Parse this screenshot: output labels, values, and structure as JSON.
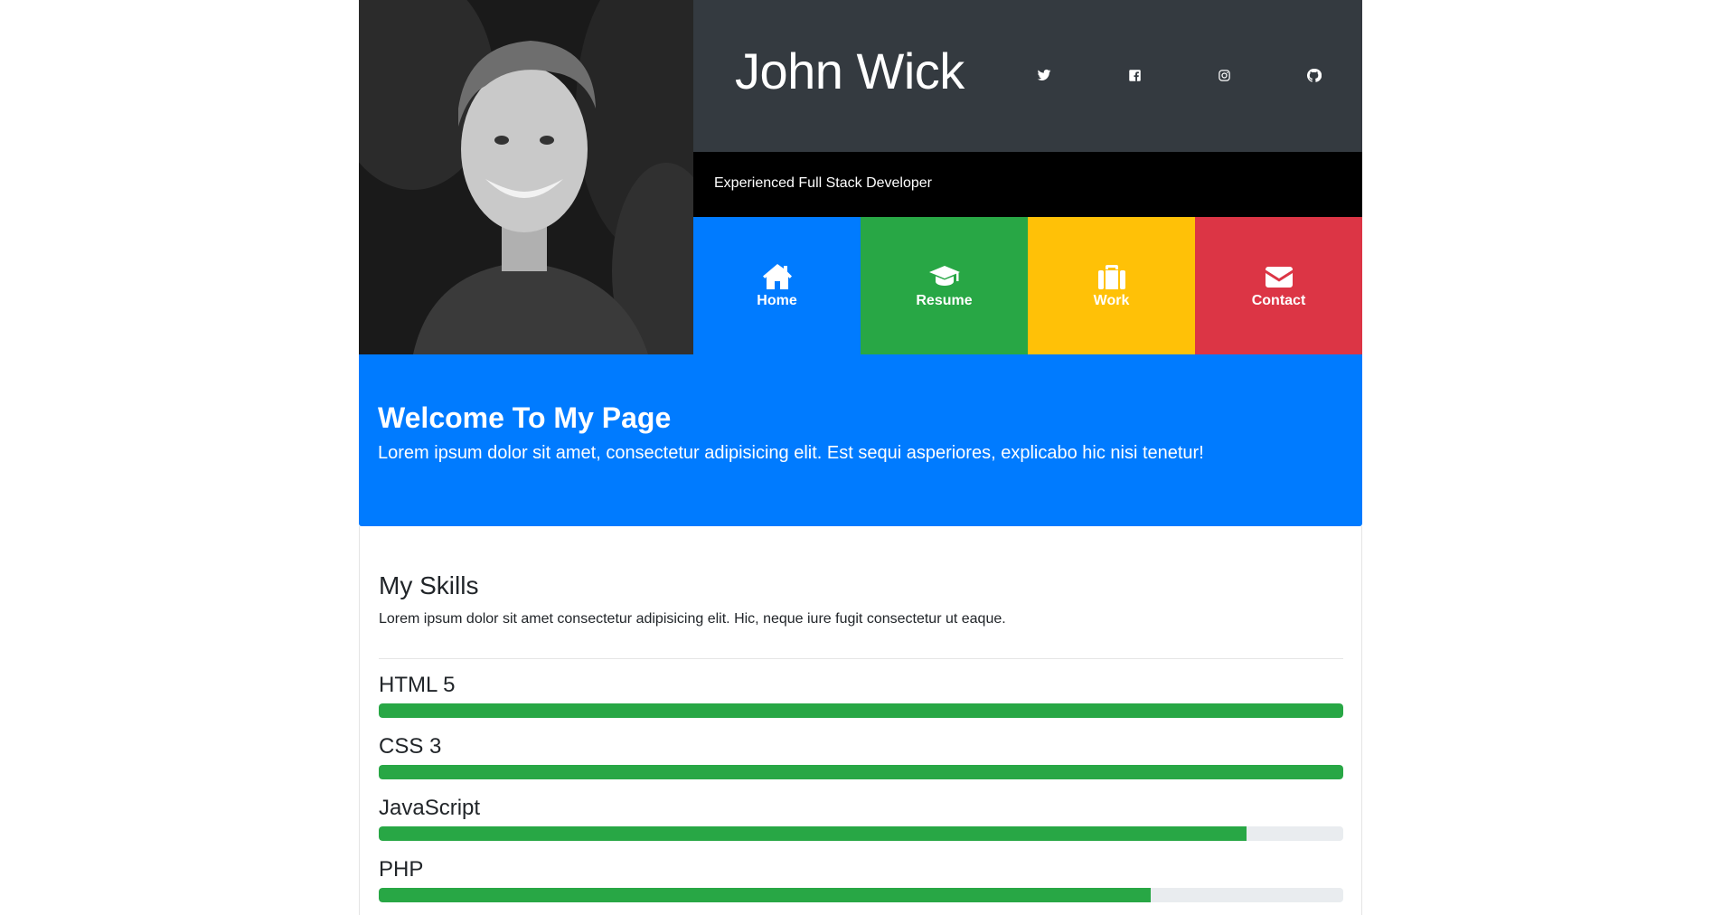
{
  "header": {
    "name": "John Wick",
    "tagline": "Experienced Full Stack Developer",
    "social": [
      {
        "icon": "twitter-icon"
      },
      {
        "icon": "facebook-icon"
      },
      {
        "icon": "instagram-icon"
      },
      {
        "icon": "github-icon"
      }
    ]
  },
  "nav": [
    {
      "label": "Home",
      "icon": "home-icon",
      "color": "#007bff"
    },
    {
      "label": "Resume",
      "icon": "graduation-cap-icon",
      "color": "#28a745"
    },
    {
      "label": "Work",
      "icon": "briefcase-icon",
      "color": "#ffc107"
    },
    {
      "label": "Contact",
      "icon": "envelope-icon",
      "color": "#dc3545"
    }
  ],
  "welcome": {
    "title": "Welcome To My Page",
    "text": "Lorem ipsum dolor sit amet, consectetur adipisicing elit. Est sequi asperiores, explicabo hic nisi tenetur!"
  },
  "skills": {
    "title": "My Skills",
    "text": "Lorem ipsum dolor sit amet consectetur adipisicing elit. Hic, neque iure fugit consectetur ut eaque.",
    "items": [
      {
        "label": "HTML 5",
        "percent": 100
      },
      {
        "label": "CSS 3",
        "percent": 100
      },
      {
        "label": "JavaScript",
        "percent": 90
      },
      {
        "label": "PHP",
        "percent": 80
      }
    ]
  },
  "colors": {
    "dark": "#343a40",
    "primary": "#007bff",
    "success": "#28a745",
    "warning": "#ffc107",
    "danger": "#dc3545"
  }
}
